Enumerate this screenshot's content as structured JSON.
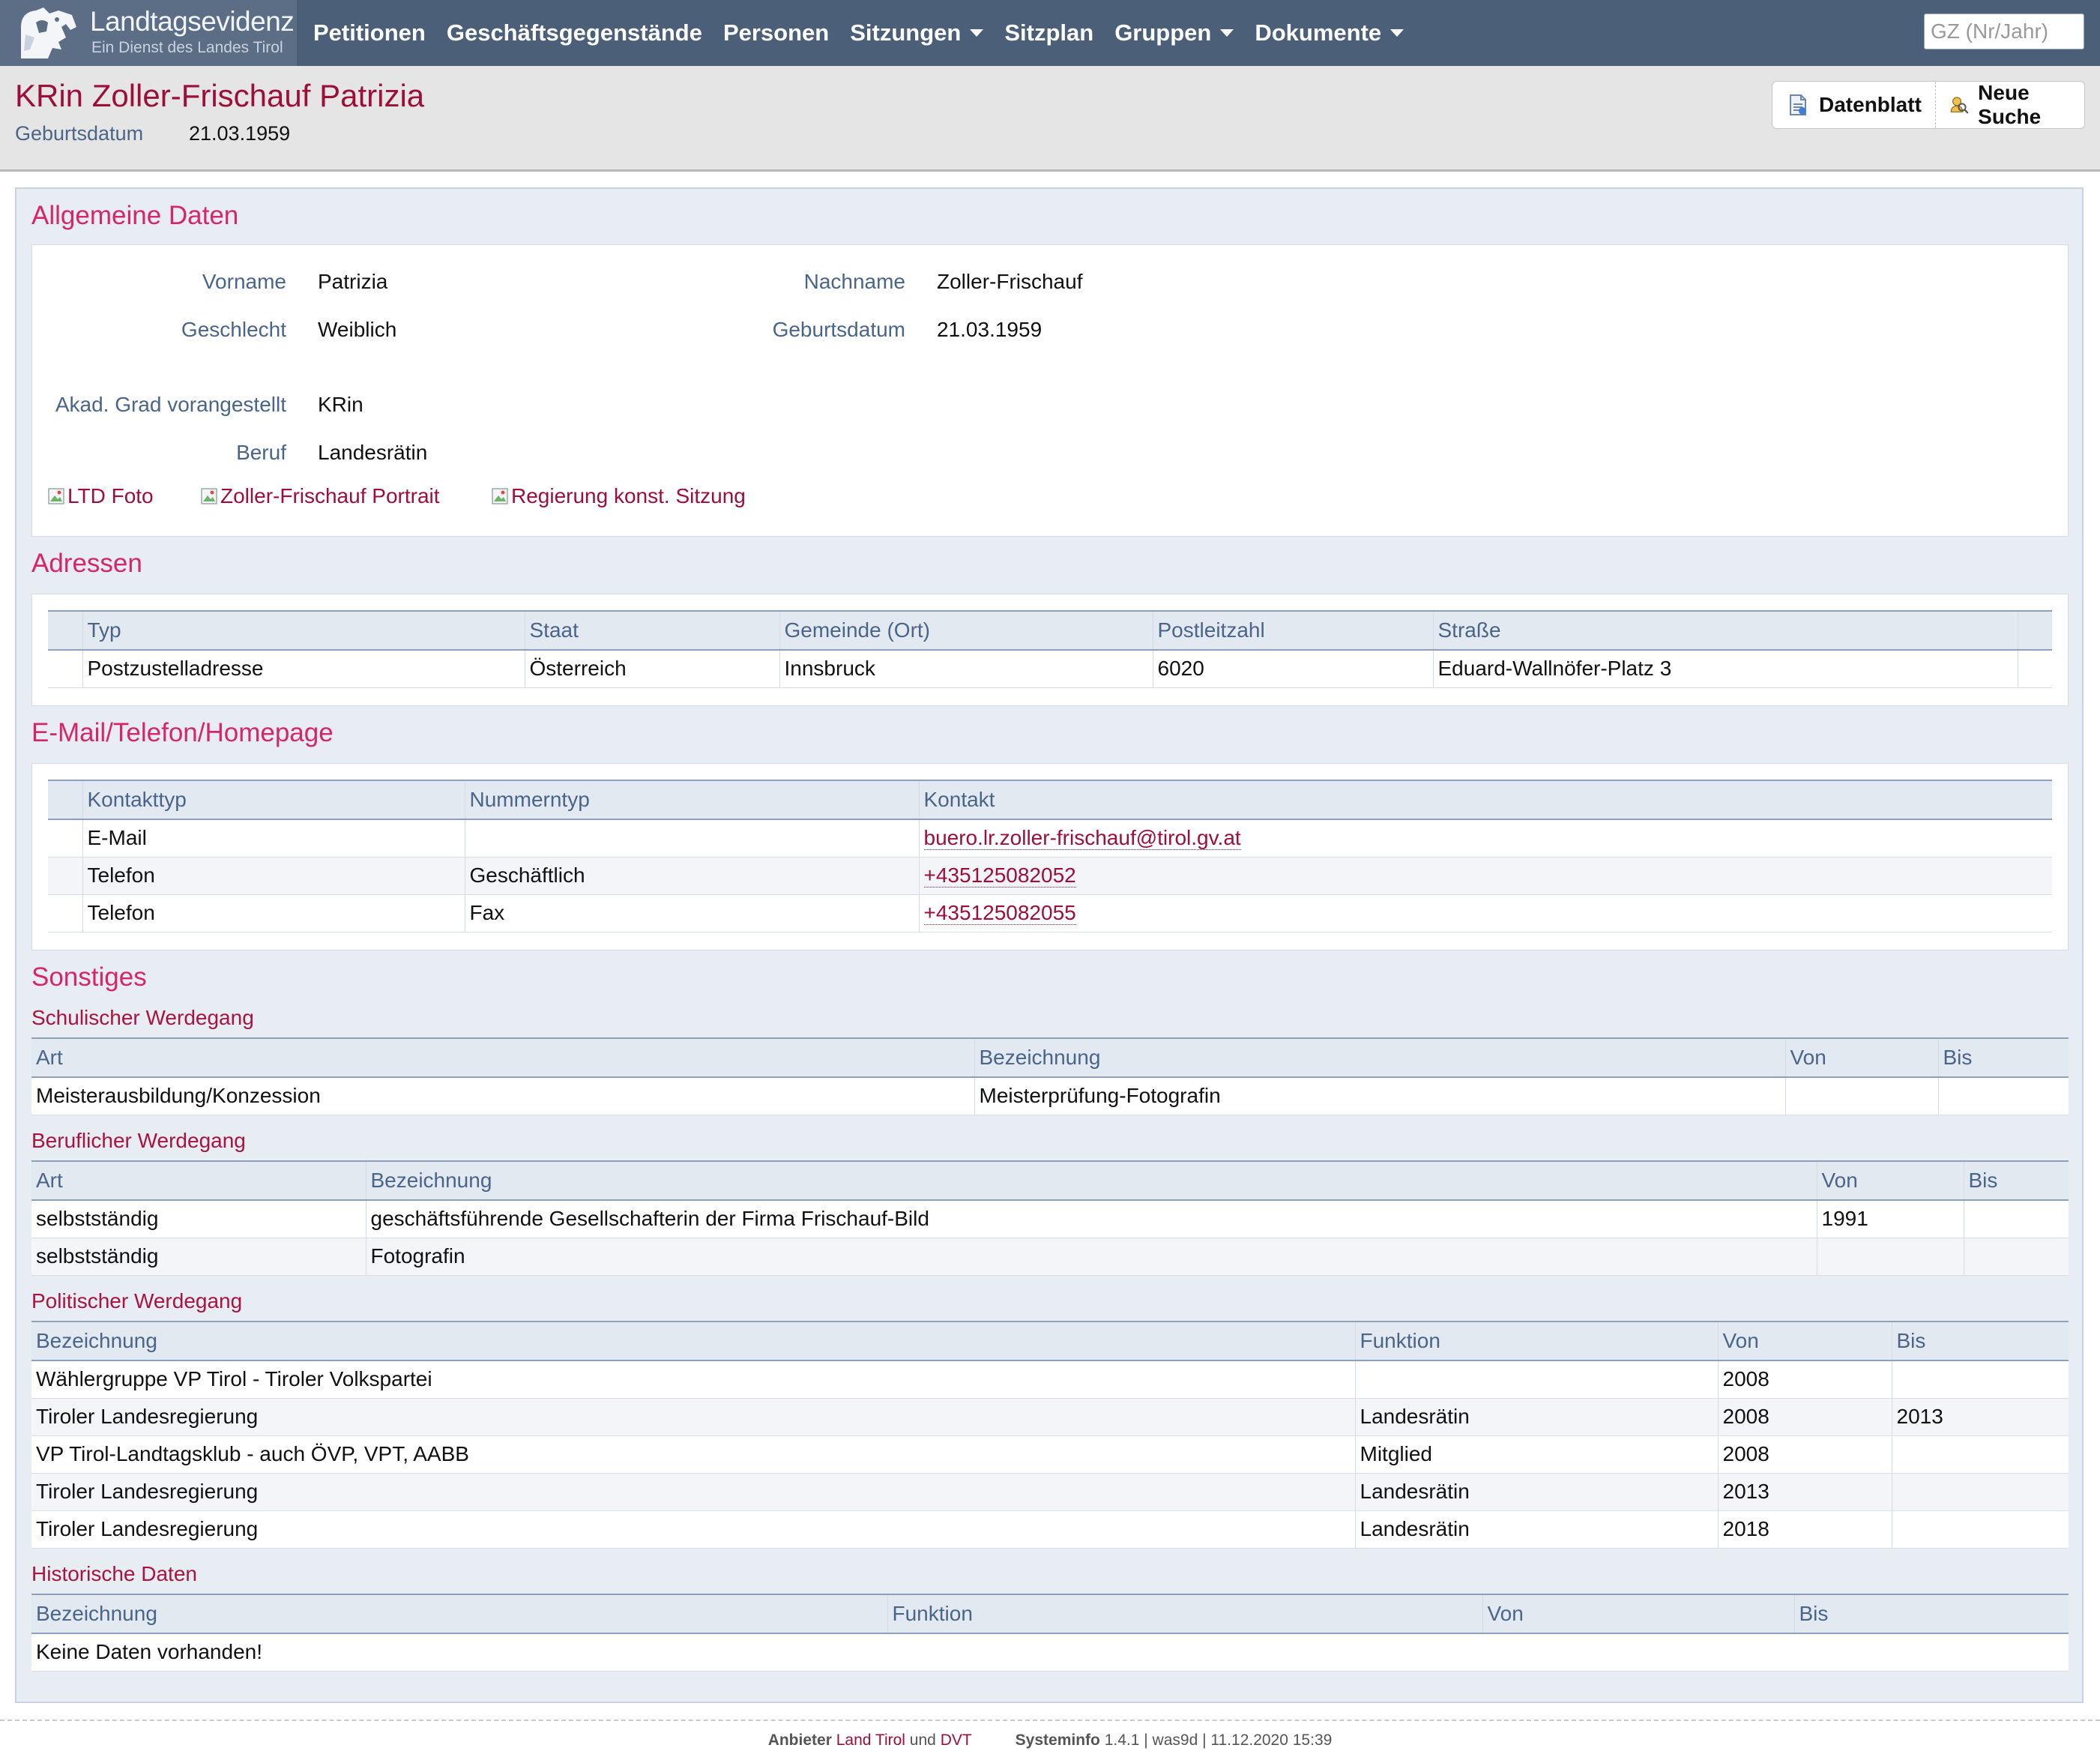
{
  "nav": {
    "logo_title": "Landtagsevidenz",
    "logo_subtitle": "Ein Dienst des Landes Tirol",
    "items": [
      {
        "label": "Petitionen",
        "dropdown": false
      },
      {
        "label": "Geschäftsgegenstände",
        "dropdown": false
      },
      {
        "label": "Personen",
        "dropdown": false
      },
      {
        "label": "Sitzungen",
        "dropdown": true
      },
      {
        "label": "Sitzplan",
        "dropdown": false
      },
      {
        "label": "Gruppen",
        "dropdown": true
      },
      {
        "label": "Dokumente",
        "dropdown": true
      }
    ],
    "gz_placeholder": "GZ (Nr/Jahr)"
  },
  "header": {
    "title": "KRin Zoller-Frischauf Patrizia",
    "birth_label": "Geburtsdatum",
    "birth_value": "21.03.1959",
    "datenblatt_label": "Datenblatt",
    "neue_suche_label": "Neue Suche"
  },
  "allgemein": {
    "heading": "Allgemeine Daten",
    "vorname_label": "Vorname",
    "vorname": "Patrizia",
    "nachname_label": "Nachname",
    "nachname": "Zoller-Frischauf",
    "geschlecht_label": "Geschlecht",
    "geschlecht": "Weiblich",
    "geburtsdatum_label": "Geburtsdatum",
    "geburtsdatum": "21.03.1959",
    "grad_label": "Akad. Grad vorangestellt",
    "grad": "KRin",
    "beruf_label": "Beruf",
    "beruf": "Landesrätin",
    "images": [
      "LTD Foto",
      "Zoller-Frischauf Portrait",
      "Regierung konst. Sitzung"
    ]
  },
  "adressen": {
    "heading": "Adressen",
    "columns": [
      "Typ",
      "Staat",
      "Gemeinde (Ort)",
      "Postleitzahl",
      "Straße"
    ],
    "rows": [
      [
        "Postzustelladresse",
        "Österreich",
        "Innsbruck",
        "6020",
        "Eduard-Wallnöfer-Platz 3"
      ]
    ]
  },
  "kontakt": {
    "heading": "E-Mail/Telefon/Homepage",
    "columns": [
      "Kontakttyp",
      "Nummerntyp",
      "Kontakt"
    ],
    "rows": [
      [
        "E-Mail",
        "",
        "buero.lr.zoller-frischauf@tirol.gv.at"
      ],
      [
        "Telefon",
        "Geschäftlich",
        "+435125082052"
      ],
      [
        "Telefon",
        "Fax",
        "+435125082055"
      ]
    ]
  },
  "sonstiges": {
    "heading": "Sonstiges",
    "schulisch": {
      "heading": "Schulischer Werdegang",
      "columns": [
        "Art",
        "Bezeichnung",
        "Von",
        "Bis"
      ],
      "rows": [
        [
          "Meisterausbildung/Konzession",
          "Meisterprüfung-Fotografin",
          "",
          ""
        ]
      ]
    },
    "beruflich": {
      "heading": "Beruflicher Werdegang",
      "columns": [
        "Art",
        "Bezeichnung",
        "Von",
        "Bis"
      ],
      "rows": [
        [
          "selbstständig",
          "geschäftsführende Gesellschafterin der Firma Frischauf-Bild",
          "1991",
          ""
        ],
        [
          "selbstständig",
          "Fotografin",
          "",
          ""
        ]
      ]
    },
    "politisch": {
      "heading": "Politischer Werdegang",
      "columns": [
        "Bezeichnung",
        "Funktion",
        "Von",
        "Bis"
      ],
      "rows": [
        [
          "Wählergruppe VP Tirol - Tiroler Volkspartei",
          "",
          "2008",
          ""
        ],
        [
          "Tiroler Landesregierung",
          "Landesrätin",
          "2008",
          "2013"
        ],
        [
          "VP Tirol-Landtagsklub - auch ÖVP, VPT, AABB",
          "Mitglied",
          "2008",
          ""
        ],
        [
          "Tiroler Landesregierung",
          "Landesrätin",
          "2013",
          ""
        ],
        [
          "Tiroler Landesregierung",
          "Landesrätin",
          "2018",
          ""
        ]
      ]
    },
    "historisch": {
      "heading": "Historische Daten",
      "columns": [
        "Bezeichnung",
        "Funktion",
        "Von",
        "Bis"
      ],
      "empty_text": "Keine Daten vorhanden!"
    }
  },
  "footer": {
    "anbieter_label": "Anbieter",
    "land_tirol": "Land Tirol",
    "und": "und",
    "dvt": "DVT",
    "systeminfo_label": "Systeminfo",
    "systeminfo_value": "1.4.1 | was9d | 11.12.2020 15:39"
  }
}
